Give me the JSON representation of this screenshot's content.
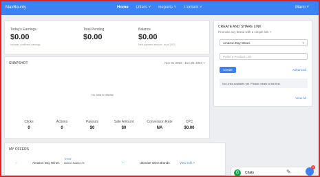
{
  "topbar": {
    "brand": "MaxBounty",
    "nav": [
      "Home",
      "Offers ˅",
      "Reports ˅",
      "Content ˅"
    ],
    "user": "Marci ˅"
  },
  "stats": [
    {
      "label": "Today's Earnings",
      "value": "$0.00",
      "note": "Includes confirmed earnings"
    },
    {
      "label": "Total Pending",
      "value": "$0.00",
      "note": ""
    },
    {
      "label": "Balance",
      "value": "$0.00",
      "note": "Next payment amount · as of 2023"
    }
  ],
  "snapshot": {
    "title": "SNAPSHOT",
    "range": "Nov 01 2023 - Dec 01 2023 ˅",
    "empty": "No data to display",
    "metrics": [
      {
        "label": "Clicks",
        "value": "0"
      },
      {
        "label": "Actions",
        "value": "0"
      },
      {
        "label": "Payouts",
        "value": "$0"
      },
      {
        "label": "Sale Amount",
        "value": "$0"
      },
      {
        "label": "Conversion Rate",
        "value": "NA"
      },
      {
        "label": "CPC",
        "value": "$0.00"
      }
    ]
  },
  "share": {
    "title": "CREATE AND SHARE LINK",
    "subtitle": "Promote any brand with a simple link ˅",
    "select_value": "Amazon Day Wines",
    "input_placeholder": "Paste a Product Link",
    "create_label": "Create",
    "advanced_label": "Advanced",
    "info": "No Links available yet. Please create a link first.",
    "view_all": "View All"
  },
  "offers": {
    "title": "MY OFFERS",
    "row": {
      "name": "Amazon Day Wines",
      "status": "Online Sales 1%",
      "tag": "Trend",
      "brand": "Ultimate Wine Brands",
      "link": "View Info ˅"
    }
  },
  "chat": {
    "label": "Chats"
  },
  "notification_count": "1"
}
